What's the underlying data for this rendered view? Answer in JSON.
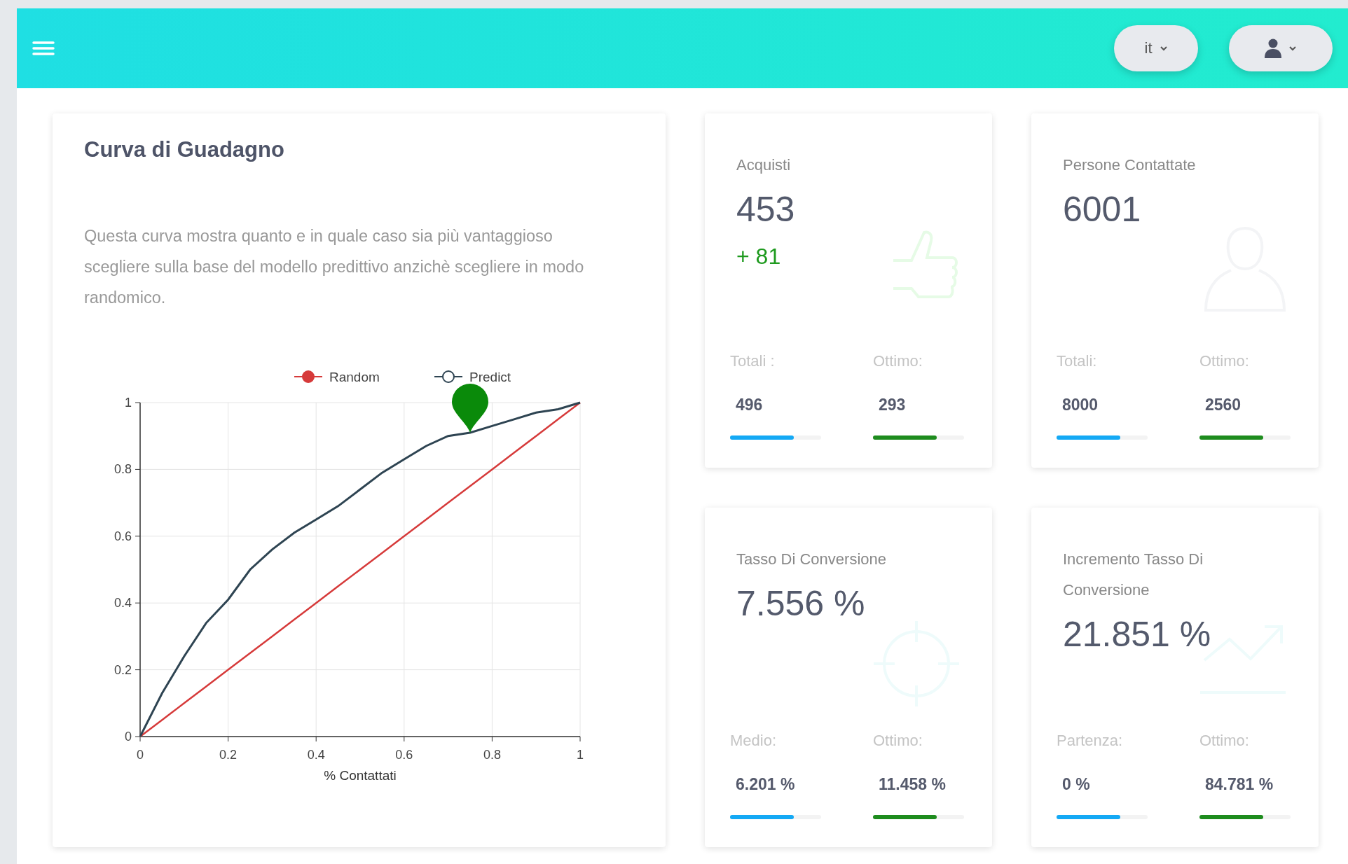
{
  "header": {
    "language": "it"
  },
  "gain_card": {
    "title": "Curva di Guadagno",
    "description": "Questa curva mostra quanto e in quale caso sia più vantaggioso scegliere sulla base del modello predittivo anzichè scegliere in modo randomico.",
    "chart_data": {
      "type": "line",
      "grid": true,
      "legend": true,
      "xlabel": "% Contattati",
      "x": [
        0,
        0.05,
        0.1,
        0.15,
        0.2,
        0.25,
        0.3,
        0.35,
        0.4,
        0.45,
        0.5,
        0.55,
        0.6,
        0.65,
        0.7,
        0.75,
        0.8,
        0.85,
        0.9,
        0.95,
        1
      ],
      "xlim": [
        0,
        1
      ],
      "ylim": [
        0,
        1
      ],
      "xticks": [
        0,
        0.2,
        0.4,
        0.6,
        0.8,
        1
      ],
      "yticks": [
        0,
        0.2,
        0.4,
        0.6,
        0.8,
        1
      ],
      "series": [
        {
          "name": "Random",
          "color": "#d63a3a",
          "values": [
            0,
            0.05,
            0.1,
            0.15,
            0.2,
            0.25,
            0.3,
            0.35,
            0.4,
            0.45,
            0.5,
            0.55,
            0.6,
            0.65,
            0.7,
            0.75,
            0.8,
            0.85,
            0.9,
            0.95,
            1
          ]
        },
        {
          "name": "Predict",
          "color": "#2e4452",
          "values": [
            0,
            0.13,
            0.24,
            0.34,
            0.41,
            0.5,
            0.56,
            0.61,
            0.65,
            0.69,
            0.74,
            0.79,
            0.83,
            0.87,
            0.9,
            0.91,
            0.93,
            0.95,
            0.97,
            0.98,
            1
          ]
        }
      ]
    }
  },
  "stat_cards": [
    {
      "title": "Acquisti",
      "value": "453",
      "delta": "+ 81",
      "stats": [
        {
          "label": "Totali :",
          "value": "496",
          "level": 0.7,
          "color": "#14a9f5"
        },
        {
          "label": "Ottimo:",
          "value": "293",
          "level": 0.7,
          "color": "#1e8c1e"
        }
      ]
    },
    {
      "title": "Persone Contattate",
      "value": "6001",
      "stats": [
        {
          "label": "Totali:",
          "value": "8000",
          "level": 0.7,
          "color": "#14a9f5"
        },
        {
          "label": "Ottimo:",
          "value": "2560",
          "level": 0.7,
          "color": "#1e8c1e"
        }
      ]
    },
    {
      "title": "Tasso Di Conversione",
      "value": "7.556 %",
      "stats": [
        {
          "label": "Medio:",
          "value": "6.201 %",
          "level": 0.7,
          "color": "#14a9f5"
        },
        {
          "label": "Ottimo:",
          "value": "11.458 %",
          "level": 0.7,
          "color": "#1e8c1e"
        }
      ]
    },
    {
      "title": "Incremento Tasso Di Conversione",
      "value": "21.851 %",
      "stats": [
        {
          "label": "Partenza:",
          "value": "0 %",
          "level": 0.7,
          "color": "#14a9f5"
        },
        {
          "label": "Ottimo:",
          "value": "84.781 %",
          "level": 0.7,
          "color": "#1e8c1e"
        }
      ]
    }
  ]
}
